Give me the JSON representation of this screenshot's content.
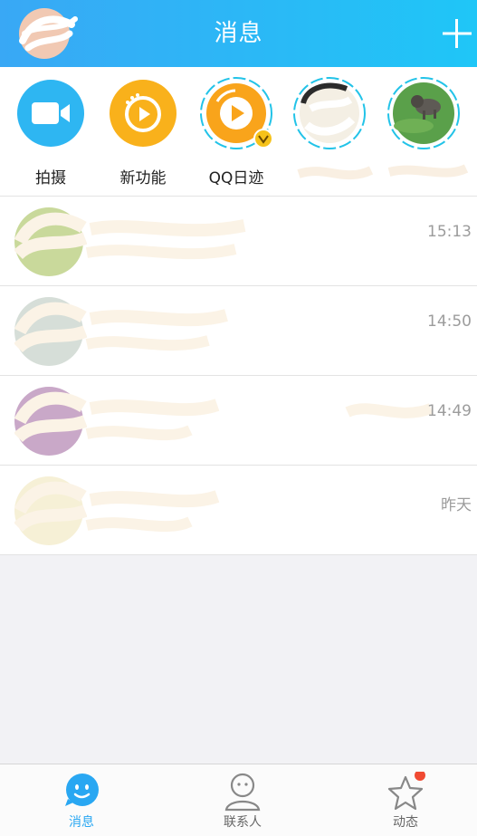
{
  "header": {
    "title": "消息",
    "avatar_icon": "user-avatar-icon",
    "add_icon": "plus-icon"
  },
  "shortcuts": [
    {
      "label": "拍摄",
      "icon": "video-camera-icon",
      "color": "#2eb6f2"
    },
    {
      "label": "新功能",
      "icon": "play-disc-icon",
      "color": "#f9b11b"
    },
    {
      "label": "QQ日迹",
      "icon": "play-disc-icon",
      "color": "#f9a41b"
    },
    {
      "label": "",
      "icon": "friend-avatar-icon",
      "color": "#22c3e8"
    },
    {
      "label": "",
      "icon": "dog-avatar-icon",
      "color": "#22c3e8"
    }
  ],
  "messages": [
    {
      "time": "15:13"
    },
    {
      "time": "14:50"
    },
    {
      "time": "14:49"
    },
    {
      "time": "昨天"
    }
  ],
  "tabs": [
    {
      "label": "消息",
      "icon": "smile-bubble-icon",
      "active": true
    },
    {
      "label": "联系人",
      "icon": "contact-person-icon",
      "active": false
    },
    {
      "label": "动态",
      "icon": "star-icon",
      "active": false
    }
  ],
  "colors": {
    "accent": "#29a7f2",
    "muted": "#9c9c9c",
    "badge": "#f04a32"
  }
}
